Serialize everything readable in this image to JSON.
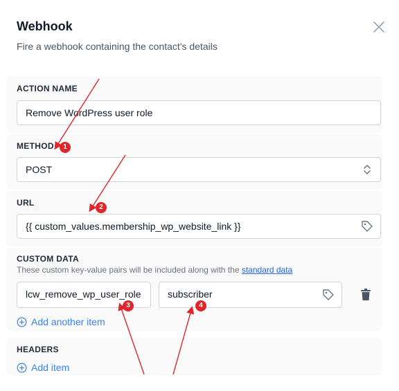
{
  "dialog": {
    "title": "Webhook",
    "subtitle": "Fire a webhook containing the contact's details"
  },
  "action_name": {
    "label": "ACTION NAME",
    "value": "Remove WordPress user role"
  },
  "method": {
    "label": "METHOD",
    "value": "POST"
  },
  "url": {
    "label": "URL",
    "value": "{{ custom_values.membership_wp_website_link }}"
  },
  "custom_data": {
    "label": "CUSTOM DATA",
    "help_text": "These custom key-value pairs will be included along with the",
    "help_link": "standard data",
    "pairs": [
      {
        "key": "lcw_remove_wp_user_role",
        "value": "subscriber"
      }
    ],
    "add_label": "Add another item"
  },
  "headers": {
    "label": "HEADERS",
    "add_label": "Add item"
  },
  "annotations": {
    "color": "#e0262b",
    "badges": [
      "1",
      "2",
      "3",
      "4"
    ]
  },
  "icons": {
    "close": "close-icon",
    "select": "chevron-updown-icon",
    "tag": "tag-icon",
    "delete": "trash-icon",
    "add": "plus-circle-icon"
  }
}
